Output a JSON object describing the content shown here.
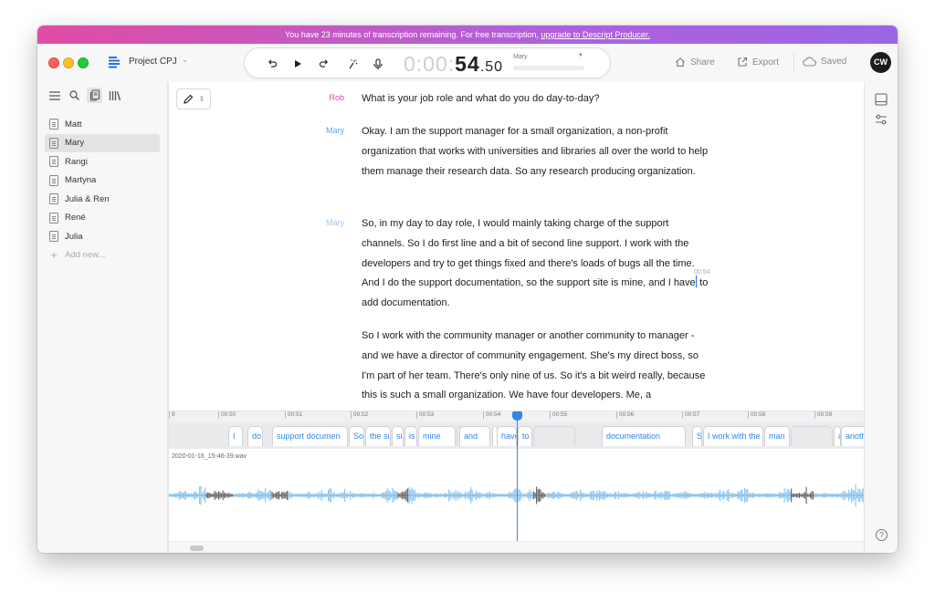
{
  "banner": {
    "text": "You have 23 minutes of transcription remaining. For free transcription, ",
    "link": "upgrade to Descript Producer."
  },
  "titlebar": {
    "project_name": "Project CPJ",
    "timecode_dim": "0:00:",
    "timecode_sec": "54",
    "timecode_frac": ".50",
    "speaker_select": "Mary",
    "share_label": "Share",
    "export_label": "Export",
    "saved_label": "Saved",
    "avatar_initials": "CW"
  },
  "sidebar": {
    "items": [
      {
        "label": "Matt"
      },
      {
        "label": "Mary"
      },
      {
        "label": "Rangi"
      },
      {
        "label": "Martyna"
      },
      {
        "label": "Julia & Ren"
      },
      {
        "label": "René"
      },
      {
        "label": "Julia"
      }
    ],
    "selected": "Mary",
    "add_label": "Add new..."
  },
  "transcript": {
    "paragraphs": [
      {
        "speaker": "Rob",
        "color": "#d64aa0",
        "text": "What is your job role and what do you do day-to-day?"
      },
      {
        "speaker": "Mary",
        "color": "#5aa9e8",
        "text": "Okay. I am the support manager for a small organization, a non-profit organization that works with universities and libraries all over the world to help them manage their research data. So any research producing organization."
      },
      {
        "speaker": "Mary",
        "color": "#9fc8ef",
        "text_before_cursor": "So, in my day to day role, I would mainly taking charge of the support channels. So I do first line and a bit of second line support.  I work with the developers and try to get things fixed and there's loads of bugs all the time. And I do the support  documentation, so the support site is mine, and I have",
        "text_after_cursor": " to add documentation.",
        "cursor_time": "00:54"
      },
      {
        "speaker": "",
        "color": "#9fc8ef",
        "text": "So I work with the community manager or another community to manager - and we have a director of community engagement. She's my direct boss, so I'm part of her team. There's only nine of us. So it's a bit weird really, because this is such a small organization. We have four developers. Me, a"
      }
    ]
  },
  "timeline": {
    "ticks": [
      "9",
      "00:50",
      "00:51",
      "00:52",
      "00:53",
      "00:54",
      "00:55",
      "00:56",
      "00:57",
      "00:58",
      "00:59"
    ],
    "words": [
      "I",
      "do",
      "support documen",
      "So",
      "the su",
      "si",
      "is",
      "mine",
      "",
      "and",
      "I",
      "have",
      "to",
      "",
      "documentation",
      "S",
      "I work with the",
      "man",
      "",
      "a",
      "anoth"
    ],
    "file_name": "2020-01-16_15-46-39.wav",
    "wave_color_active": "#8ec8f3",
    "wave_color_idle": "#6d6d70",
    "playhead_color": "#2f86e9"
  }
}
